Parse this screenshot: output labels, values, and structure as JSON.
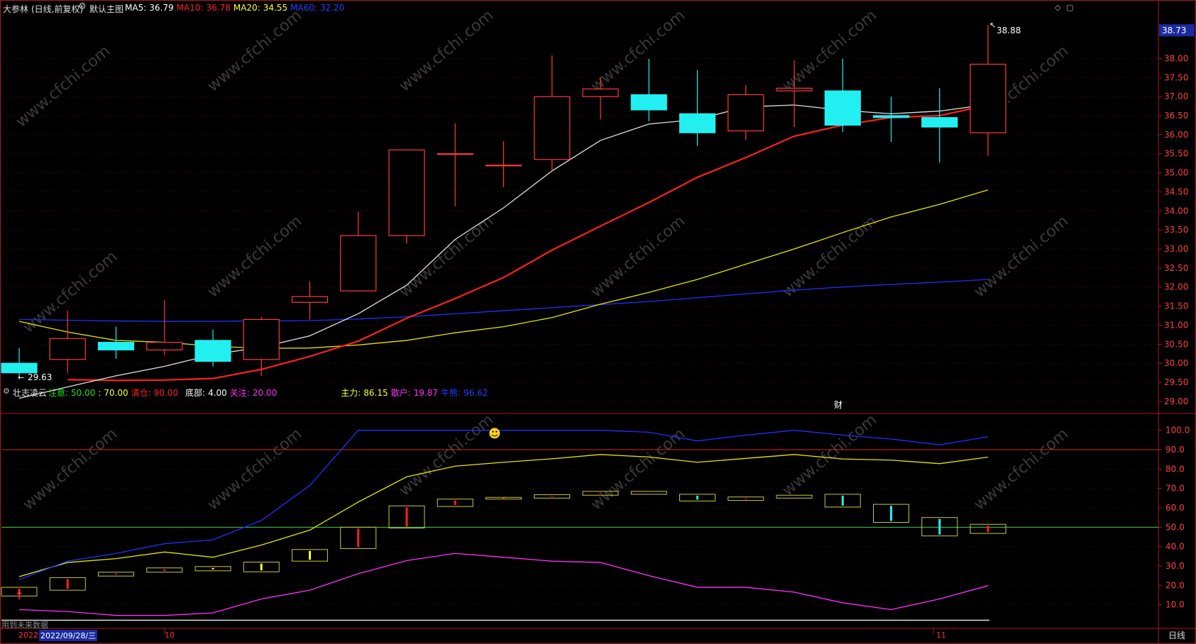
{
  "header": {
    "stock_name": "大参林",
    "period": "(日线,前复权)",
    "template": "默认主图",
    "ma": [
      {
        "label": "MA5:",
        "value": "36.79",
        "color": "#ffffff"
      },
      {
        "label": "MA10:",
        "value": "36.78",
        "color": "#ff2020"
      },
      {
        "label": "MA20:",
        "value": "34.55",
        "color": "#ffff30"
      },
      {
        "label": "MA60:",
        "value": "32.20",
        "color": "#2040ff"
      }
    ]
  },
  "indicator": {
    "name": "壮志凌云",
    "params": [
      {
        "label": "注意:",
        "value": "50.00",
        "color": "#20e020"
      },
      {
        "label": "",
        "value": ": 70.00",
        "color": "#ffff30"
      },
      {
        "label": "清仓:",
        "value": "90.00",
        "color": "#ff2020"
      },
      {
        "label": "底部:",
        "value": "4.00",
        "color": "#ffffff"
      },
      {
        "label": "关注:",
        "value": "20.00",
        "color": "#ff30ff"
      },
      {
        "label": "主力:",
        "value": "86.15",
        "color": "#ffff30"
      },
      {
        "label": "散户:",
        "value": "19.87",
        "color": "#ff30ff"
      },
      {
        "label": "牛熊:",
        "value": "96.62",
        "color": "#2040ff"
      }
    ],
    "y_ticks": [
      10,
      20,
      30,
      40,
      50,
      60,
      70,
      80,
      90,
      100
    ]
  },
  "price_axis": {
    "ticks": [
      "29.00",
      "29.50",
      "30.00",
      "30.50",
      "31.00",
      "31.50",
      "32.00",
      "32.50",
      "33.00",
      "33.50",
      "34.00",
      "34.50",
      "35.00",
      "35.50",
      "36.00",
      "36.50",
      "37.00",
      "37.50",
      "38.00"
    ],
    "current": "38.73"
  },
  "annotations": {
    "high": "38.88",
    "low": "29.63",
    "finance_marker": "财",
    "smiley": "☻"
  },
  "footer": {
    "year_partial": "2022",
    "cursor_date": "2022/09/28/三",
    "month_10": "10",
    "month_11": "11",
    "future_data_text": "用到未来数据",
    "period_button": "日线"
  },
  "watermark": "www.cfchi.com",
  "colors": {
    "up": "#ff3b3b",
    "down": "#22f0f0",
    "bg": "#000000",
    "border": "#b01818"
  },
  "chart_data": [
    {
      "type": "candlestick",
      "title": "大参林",
      "x": [
        "09/28",
        "09/29",
        "09/30",
        "10/10",
        "10/11",
        "10/12",
        "10/13",
        "10/14",
        "10/17",
        "10/18",
        "10/19",
        "10/20",
        "10/21",
        "10/24",
        "10/25",
        "10/26",
        "10/27",
        "10/28",
        "10/31",
        "11/01",
        "11/02"
      ],
      "open": [
        30.0,
        30.1,
        30.55,
        30.35,
        30.6,
        30.1,
        31.6,
        31.9,
        33.35,
        35.5,
        35.2,
        35.35,
        37.0,
        37.05,
        36.55,
        36.1,
        37.15,
        37.15,
        36.5,
        36.45,
        36.05
      ],
      "high": [
        30.4,
        31.38,
        30.96,
        31.66,
        30.88,
        31.22,
        32.15,
        33.98,
        34.88,
        36.3,
        35.83,
        38.08,
        37.52,
        37.99,
        37.7,
        37.3,
        37.95,
        37.99,
        37.0,
        37.22,
        38.88
      ],
      "low": [
        29.63,
        29.75,
        30.12,
        30.22,
        29.92,
        29.66,
        31.15,
        31.9,
        33.14,
        34.12,
        34.62,
        35.05,
        36.4,
        36.35,
        35.7,
        35.86,
        36.2,
        36.07,
        35.81,
        35.27,
        35.44
      ],
      "close": [
        29.75,
        30.65,
        30.35,
        30.55,
        30.05,
        31.15,
        31.75,
        33.35,
        35.6,
        35.5,
        35.2,
        37.0,
        37.2,
        36.65,
        36.05,
        37.05,
        37.22,
        36.25,
        36.45,
        36.2,
        37.85
      ],
      "ma5": [
        29.08,
        29.38,
        29.67,
        29.92,
        30.23,
        30.42,
        30.72,
        31.3,
        32.05,
        33.25,
        34.08,
        35.05,
        35.85,
        36.28,
        36.4,
        36.73,
        36.78,
        36.64,
        36.55,
        36.62,
        36.79
      ],
      "ma10": [
        null,
        29.57,
        29.55,
        29.56,
        29.6,
        29.84,
        30.18,
        30.58,
        31.18,
        31.7,
        32.25,
        32.97,
        33.6,
        34.22,
        34.88,
        35.4,
        35.96,
        36.25,
        36.45,
        36.5,
        36.78
      ],
      "ma20": [
        31.1,
        30.82,
        30.6,
        30.55,
        30.45,
        30.39,
        30.4,
        30.48,
        30.6,
        30.8,
        30.96,
        31.2,
        31.55,
        31.86,
        32.2,
        32.6,
        33.0,
        33.43,
        33.84,
        34.17,
        34.55
      ],
      "ma60": [
        31.15,
        31.13,
        31.11,
        31.1,
        31.1,
        31.11,
        31.12,
        31.16,
        31.22,
        31.3,
        31.38,
        31.46,
        31.54,
        31.62,
        31.72,
        31.82,
        31.92,
        32.0,
        32.07,
        32.13,
        32.2
      ],
      "ylim": [
        28.7,
        39.2
      ]
    },
    {
      "type": "line",
      "title": "壮志凌云",
      "x": [
        "09/28",
        "09/29",
        "09/30",
        "10/10",
        "10/11",
        "10/12",
        "10/13",
        "10/14",
        "10/17",
        "10/18",
        "10/19",
        "10/20",
        "10/21",
        "10/24",
        "10/25",
        "10/26",
        "10/27",
        "10/28",
        "10/31",
        "11/01",
        "11/02"
      ],
      "series": [
        {
          "name": "主力",
          "color": "#e6e600",
          "values": [
            24.5,
            31.8,
            33.8,
            37.2,
            34.5,
            40.8,
            48.5,
            63.0,
            76.0,
            81.5,
            83.5,
            85.3,
            87.5,
            86.2,
            83.5,
            85.5,
            87.5,
            85.2,
            84.6,
            82.8,
            86.15
          ]
        },
        {
          "name": "散户",
          "color": "#ff30ff",
          "values": [
            7.5,
            6.5,
            4.5,
            4.5,
            5.8,
            13.0,
            17.5,
            26.0,
            32.8,
            36.5,
            34.5,
            32.5,
            31.8,
            25.0,
            19.0,
            19.0,
            16.5,
            11.0,
            7.5,
            13.0,
            19.87
          ]
        },
        {
          "name": "牛熊",
          "color": "#2030ff",
          "values": [
            23.0,
            32.5,
            36.5,
            41.5,
            43.5,
            53.5,
            71.5,
            100.0,
            100.0,
            100.0,
            100.0,
            100.0,
            100.0,
            99.0,
            94.5,
            97.5,
            100.0,
            97.5,
            95.5,
            92.5,
            96.62
          ]
        }
      ],
      "bars": {
        "low": [
          14.5,
          17.5,
          24.8,
          26.8,
          27.5,
          27.0,
          32.5,
          39.0,
          49.6,
          60.7,
          64.5,
          65.0,
          66.5,
          67.0,
          63.5,
          63.8,
          65.0,
          60.4,
          52.5,
          45.5,
          46.8
        ],
        "high": [
          19.0,
          24.0,
          26.8,
          29.0,
          29.7,
          32.0,
          38.5,
          50.0,
          61.0,
          64.5,
          65.4,
          66.8,
          68.5,
          68.5,
          67.0,
          65.6,
          66.5,
          67.0,
          61.8,
          55.0,
          51.5
        ],
        "color": [
          "#ff2020",
          "#ff2020",
          "#ff2020",
          "#ff2020",
          "#ffff30",
          "#ffff30",
          "#ffff30",
          "#ff2020",
          "#ff2020",
          "#ff2020",
          "#ff2020",
          "#ff2020",
          "#ff2020",
          "#ff2020",
          "#22f0f0",
          "#ff2020",
          "#ff2020",
          "#22f0f0",
          "#22f0f0",
          "#22f0f0",
          "#ff2020"
        ]
      },
      "hlines": [
        {
          "value": 90,
          "color": "#e02020"
        },
        {
          "value": 50,
          "color": "#40d040"
        }
      ],
      "ylim": [
        0,
        105
      ]
    }
  ]
}
